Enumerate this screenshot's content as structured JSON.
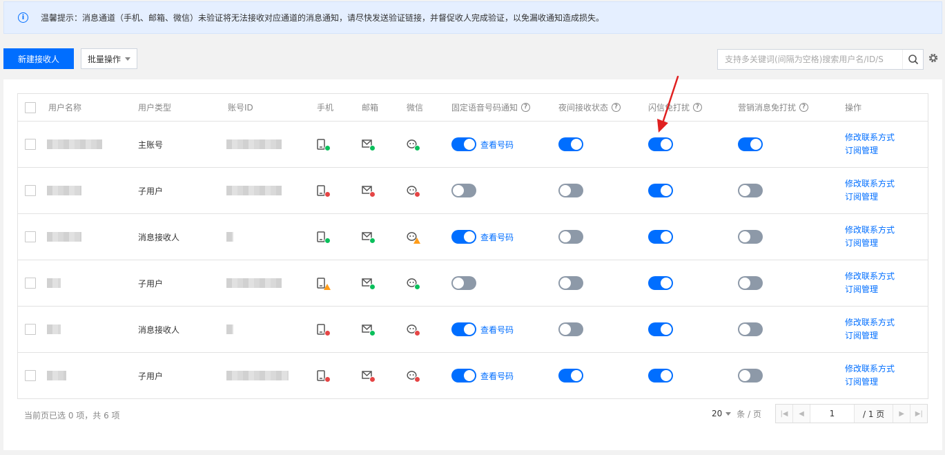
{
  "notice": {
    "icon": "info-icon",
    "text": "温馨提示：消息通道（手机、邮箱、微信）未验证将无法接收对应通道的消息通知，请尽快发送验证链接，并督促收人完成验证，以免漏收通知造成损失。"
  },
  "toolbar": {
    "new_label": "新建接收人",
    "batch_label": "批量操作",
    "search_placeholder": "支持多关键词(间隔为空格)搜索用户名/ID/S"
  },
  "table": {
    "headers": {
      "name": "用户名称",
      "type": "用户类型",
      "account": "账号ID",
      "phone": "手机",
      "email": "邮箱",
      "wechat": "微信",
      "voice": "固定语音号码通知",
      "night": "夜间接收状态",
      "flash": "闪信免打扰",
      "marketing": "营销消息免打扰",
      "ops": "操作"
    },
    "rows": [
      {
        "type": "主账号",
        "name_w": 80,
        "acct_w": 80,
        "phone": "ok",
        "email": "ok",
        "wechat": "ok",
        "voice": true,
        "voice_link": "查看号码",
        "night": true,
        "flash": true,
        "marketing": true,
        "op1": "修改联系方式",
        "op2": "订阅管理"
      },
      {
        "type": "子用户",
        "name_w": 50,
        "acct_w": 80,
        "phone": "err",
        "email": "err",
        "wechat": "err",
        "voice": false,
        "voice_link": "",
        "night": false,
        "flash": true,
        "marketing": false,
        "op1": "修改联系方式",
        "op2": "订阅管理"
      },
      {
        "type": "消息接收人",
        "name_w": 50,
        "acct_w": 10,
        "phone": "ok",
        "email": "ok",
        "wechat": "warn",
        "voice": true,
        "voice_link": "查看号码",
        "night": false,
        "flash": true,
        "marketing": false,
        "op1": "修改联系方式",
        "op2": "订阅管理"
      },
      {
        "type": "子用户",
        "name_w": 20,
        "acct_w": 80,
        "phone": "warn",
        "email": "ok",
        "wechat": "ok",
        "voice": false,
        "voice_link": "",
        "night": false,
        "flash": true,
        "marketing": false,
        "op1": "修改联系方式",
        "op2": "订阅管理"
      },
      {
        "type": "消息接收人",
        "name_w": 20,
        "acct_w": 10,
        "phone": "err",
        "email": "ok",
        "wechat": "err",
        "voice": true,
        "voice_link": "查看号码",
        "night": false,
        "flash": true,
        "marketing": false,
        "op1": "修改联系方式",
        "op2": "订阅管理"
      },
      {
        "type": "子用户",
        "name_w": 28,
        "acct_w": 90,
        "phone": "err",
        "email": "err",
        "wechat": "err",
        "voice": true,
        "voice_link": "查看号码",
        "night": true,
        "flash": true,
        "marketing": false,
        "op1": "修改联系方式",
        "op2": "订阅管理"
      }
    ]
  },
  "footer": {
    "selection": "当前页已选 0 项，共 6 项",
    "page_size": "20",
    "page_size_unit": "条 / 页",
    "current_page": "1",
    "total_pages": "/ 1 页"
  },
  "colors": {
    "primary": "#006eff",
    "ok": "#0abf5b",
    "error": "#e54545",
    "warn": "#ff9c19",
    "arrow": "#e02020"
  }
}
